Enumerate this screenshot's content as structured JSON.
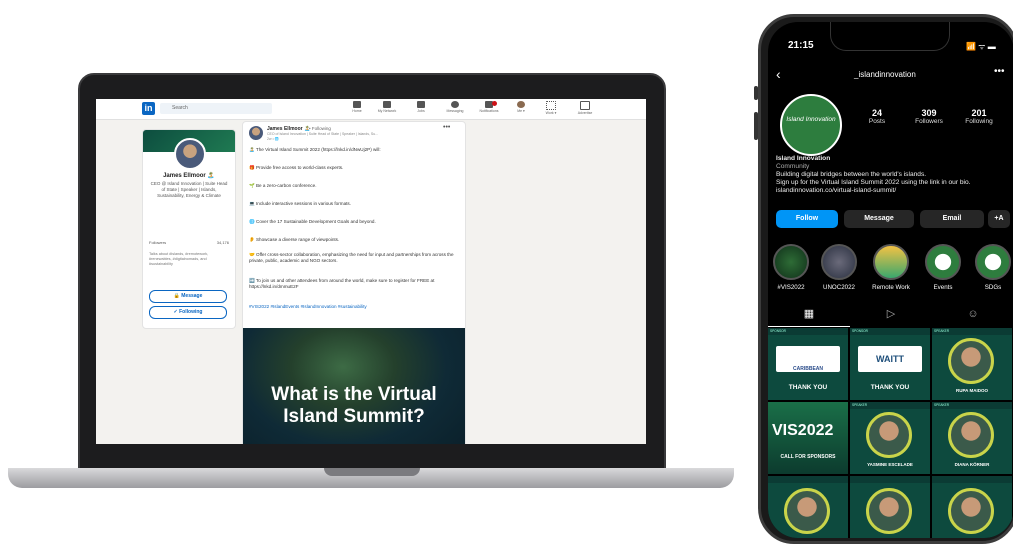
{
  "linkedin": {
    "search_placeholder": "Search",
    "nav": [
      {
        "label": "Home",
        "icon": "home-icon"
      },
      {
        "label": "My Network",
        "icon": "network-icon"
      },
      {
        "label": "Jobs",
        "icon": "briefcase-icon"
      },
      {
        "label": "Messaging",
        "icon": "message-icon"
      },
      {
        "label": "Notifications",
        "icon": "bell-icon"
      },
      {
        "label": "Me ▾",
        "icon": "avatar-icon"
      },
      {
        "label": "Work ▾",
        "icon": "grid-icon"
      },
      {
        "label": "Advertise",
        "icon": "advertise-icon"
      }
    ],
    "profile": {
      "name": "James Ellmoor 🏝️",
      "headline": "CEO @ Island Innovation | Suite Head of State | Speaker | Islands, Sustainability, Energy & Climate",
      "followers_label": "Followers",
      "followers_count": "34,176",
      "talks_about": "Talks about #islands, #remotework, #renewables, #digitalnomads, and #sustainability",
      "message_label": "Message",
      "following_label": "✓ Following"
    },
    "post": {
      "author": "James Ellmoor 🏝️",
      "follow_state": "• Following",
      "subtitle": "CEO of Island Innovation | Suite Head of State | Speaker | Islands, Su...",
      "time": "2w • 🌐",
      "lines": [
        "🏝️ The Virtual Island Summit 2022 (https://lnkd.in/dNwUj2P) will:",
        "🎁 Provide free access to world-class experts.",
        "🌱 Be a zero-carbon conference.",
        "💻 Include interactive sessions in various formats.",
        "🌐 Cover the 17 Sustainable Development Goals and beyond.",
        "👂 Showcase a diverse range of viewpoints.",
        "🤝 Offer cross-sector collaboration, emphasizing the need for input and partnerships from across the private, public, academic and NGO sectors.",
        "➡️ To join us and other attendees from around the world, make sure to register for FREE at https://lnkd.in/dmmuE2F",
        "#VIS2022 #IslandEvents #IslandInnovation #sustainability"
      ],
      "image_title": "What is the Virtual Island Summit?"
    }
  },
  "instagram": {
    "time": "21:15",
    "status": "📶 ᯤ ▬",
    "username": "_islandinnovation",
    "logo_text": "Island Innovation",
    "stats": [
      {
        "n": "24",
        "l": "Posts"
      },
      {
        "n": "309",
        "l": "Followers"
      },
      {
        "n": "201",
        "l": "Following"
      }
    ],
    "bio": [
      "Island Innovation",
      "Community",
      "Building digital bridges between the world's islands.",
      "Sign up for the Virtual Island Summit 2022 using the link in our bio.",
      "islandinnovation.co/virtual-island-summit/"
    ],
    "buttons": {
      "follow": "Follow",
      "message": "Message",
      "email": "Email",
      "add": "+A"
    },
    "highlights": [
      "#VIS2022",
      "UNOC2022",
      "Remote Work",
      "Events",
      "SDGs"
    ],
    "grid": [
      {
        "hdr": "SPONSOR",
        "title": "THANK YOU",
        "brand": "CARIBBEAN"
      },
      {
        "hdr": "SPONSOR",
        "title": "THANK YOU",
        "brand": "WAITT"
      },
      {
        "hdr": "SPEAKER",
        "title": "RUPA MAIDOO",
        "brand": ""
      },
      {
        "hdr": "",
        "title": "VIS2022",
        "brand": "CALL FOR SPONSORS"
      },
      {
        "hdr": "SPEAKER",
        "title": "YASMINE ESCELADE",
        "brand": ""
      },
      {
        "hdr": "SPEAKER",
        "title": "DIANA KÖRNER",
        "brand": ""
      }
    ],
    "colors": {
      "follow": "#0095f6",
      "logo": "#2d7d3e"
    }
  }
}
